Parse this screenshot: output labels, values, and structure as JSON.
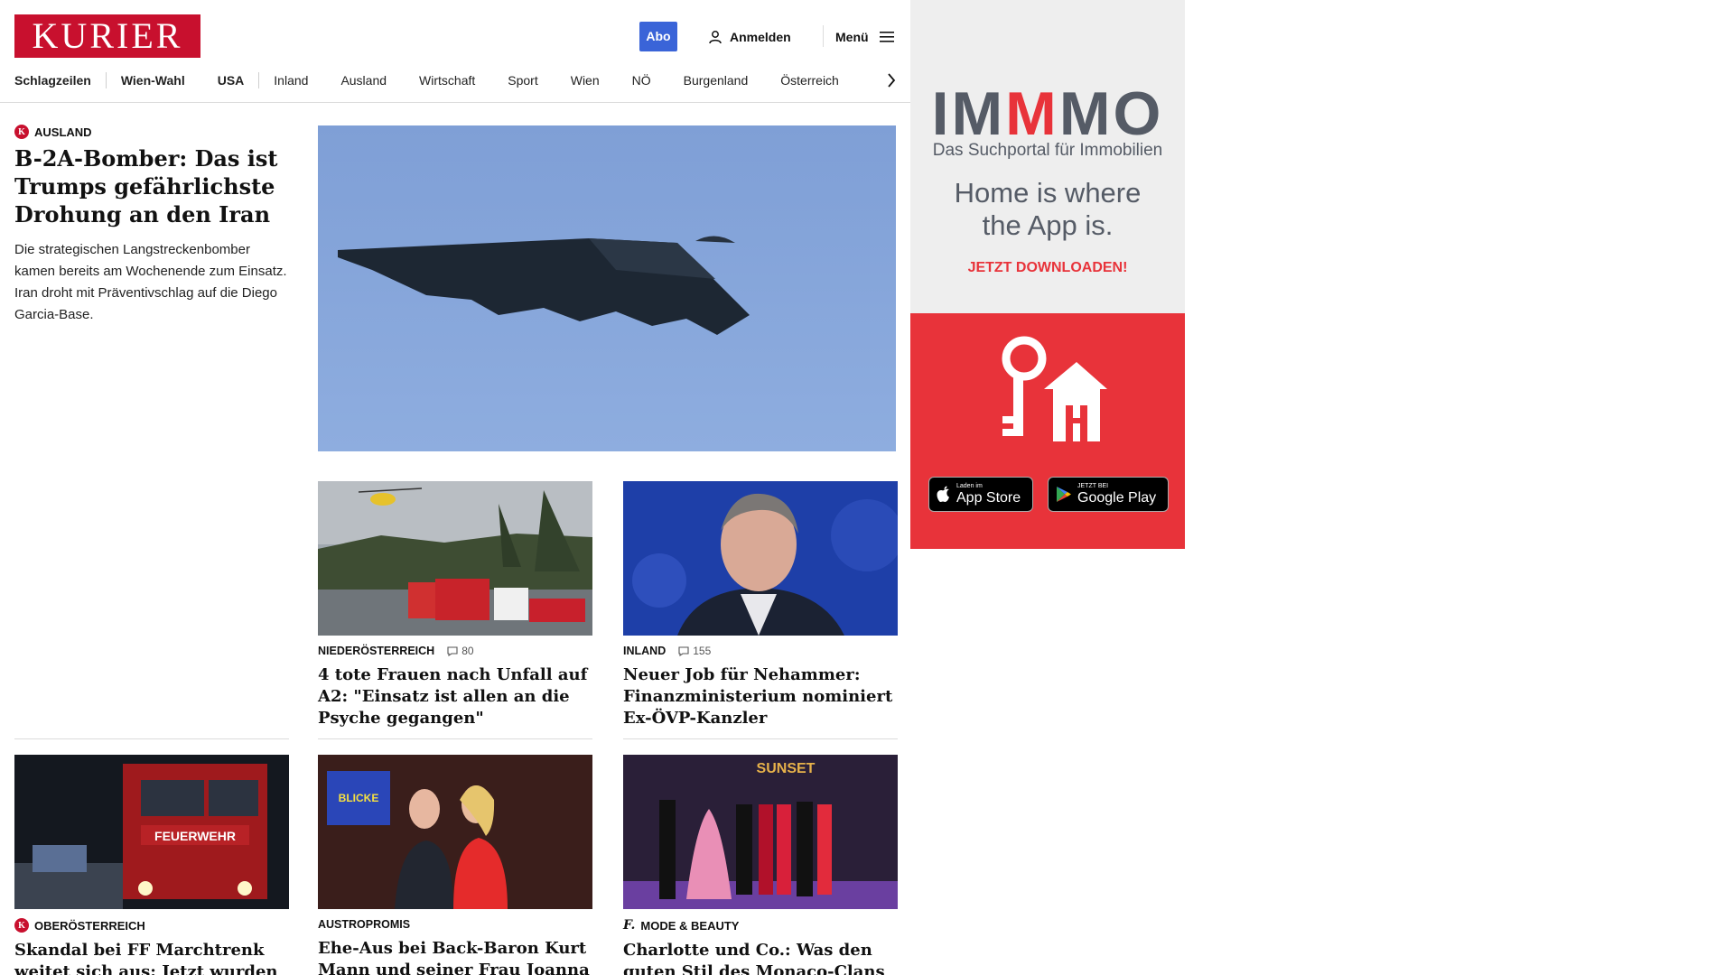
{
  "header": {
    "logo": "KURIER",
    "abo": "Abo",
    "login": "Anmelden",
    "menu": "Menü"
  },
  "nav": {
    "items": [
      "Schlagzeilen",
      "Wien-Wahl",
      "USA",
      "Inland",
      "Ausland",
      "Wirtschaft",
      "Sport",
      "Wien",
      "NÖ",
      "Burgenland",
      "Österreich"
    ]
  },
  "hero": {
    "category": "AUSLAND",
    "title": "B-2A-Bomber: Das ist Trumps gefährlichste Drohung an den Iran",
    "teaser": "Die strategischen Langstreckenbomber kamen bereits am Wochenende zum Einsatz. Iran droht mit Präventivschlag auf die Diego Garcia-Base."
  },
  "articles": [
    {
      "category": "NIEDERÖSTERREICH",
      "comments": "80",
      "title": "4 tote Frauen nach Unfall auf A2: \"Einsatz ist allen an die Psyche gegangen\""
    },
    {
      "category": "INLAND",
      "comments": "155",
      "title": "Neuer Job für Nehammer: Finanzministerium nominiert Ex-ÖVP-Kanzler"
    },
    {
      "category": "OBERÖSTERREICH",
      "title": "Skandal bei FF Marchtrenk weitet sich aus: Jetzt wurden die Handys beschlagnahmt"
    },
    {
      "category": "AUSTROPROMIS",
      "title": "Ehe-Aus bei Back-Baron Kurt Mann und seiner Frau Joanna"
    },
    {
      "category": "MODE & BEAUTY",
      "title": "Charlotte und Co.: Was den guten Stil des Monaco-Clans ausmacht"
    }
  ],
  "ad": {
    "logo_parts": [
      "IM",
      "M",
      "MO"
    ],
    "subtitle": "Das Suchportal für Immobilien",
    "slogan_line1": "Home is where",
    "slogan_line2": "the App is.",
    "cta": "JETZT DOWNLOADEN!",
    "appstore_small": "Laden im",
    "appstore_big": "App Store",
    "googleplay_small": "JETZT BEI",
    "googleplay_big": "Google Play"
  },
  "image_texts": {
    "firetruck_label": "FEUERWEHR",
    "gala_sign": "BLICKE",
    "sunset_sign": "SUNSET"
  },
  "colors": {
    "brand_red": "#c8102e",
    "abo_blue": "#3a64d8",
    "ad_red": "#e8333a",
    "ad_gray_text": "#555b66"
  }
}
